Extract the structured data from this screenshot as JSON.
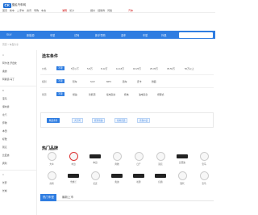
{
  "colors": {
    "brand_blue": "#2f7de1",
    "accent_red": "#cc0000"
  },
  "header": {
    "logo_mark": "CK",
    "logo_text": "惠民汽车网",
    "top_links": [
      "首页",
      "新车",
      "二手车",
      "资讯",
      "导购",
      "车友"
    ],
    "city_links": [
      "湖南",
      "长沙"
    ],
    "right_links": [
      "报价",
      "经销商",
      "问答"
    ],
    "brand_text": "汽车"
  },
  "nav": {
    "items": [
      "SUV",
      "新能源",
      "车型",
      "试驾",
      "新手导购",
      "选车",
      "车型",
      "外观",
      "文章"
    ],
    "search_placeholder": ""
  },
  "breadcrumb": "首页 > 车型大全",
  "sidebar": {
    "items": [
      "A",
      "阿尔法·罗密欧",
      "奥迪",
      "阿斯顿·马丁",
      "B",
      "宝马",
      "保时捷",
      "北汽",
      "奔驰",
      "本田",
      "标致",
      "别克",
      "比亚迪",
      "宾利",
      "C",
      "长安",
      "长城"
    ]
  },
  "filters": {
    "title": "选车条件",
    "rows": [
      {
        "label": "价格",
        "selected": "不限",
        "options": [
          "5万以下",
          "5-8万",
          "8-12万",
          "12-18万",
          "18-25万",
          "25-35万",
          "35-50万",
          "50万以上"
        ]
      },
      {
        "label": "级别",
        "selected": "不限",
        "options": [
          "轿车",
          "SUV",
          "MPV",
          "跑车",
          "皮卡",
          "微面"
        ]
      },
      {
        "label": "能源",
        "selected": "不限",
        "options": [
          "燃油",
          "新能源",
          "插电混动",
          "纯电",
          "油电混合",
          "增程式"
        ]
      }
    ],
    "tags": [
      "精选条件",
      "大空间",
      "经济省油",
      "家用首选",
      "高性价比"
    ]
  },
  "hot_brands": {
    "title": "热门品牌",
    "items": [
      {
        "name": "大众",
        "icon": "vw-logo-icon",
        "style": "circle"
      },
      {
        "name": "丰田",
        "icon": "toyota-logo-icon",
        "style": "red"
      },
      {
        "name": "本田",
        "icon": "honda-logo-icon",
        "style": "wide"
      },
      {
        "name": "奔驰",
        "icon": "benz-logo-icon",
        "style": "circle"
      },
      {
        "name": "日产",
        "icon": "nissan-logo-icon",
        "style": "circle"
      },
      {
        "name": "别克",
        "icon": "buick-logo-icon",
        "style": "circle"
      },
      {
        "name": "比亚迪",
        "icon": "byd-logo-icon",
        "style": "wide"
      },
      {
        "name": "宝马",
        "icon": "bmw-logo-icon",
        "style": "circle"
      },
      {
        "name": "吉利",
        "icon": "geely-logo-icon",
        "style": "circle"
      },
      {
        "name": "雪佛兰",
        "icon": "chevrolet-logo-icon",
        "style": "wide"
      },
      {
        "name": "长安",
        "icon": "changan-logo-icon",
        "style": "circle"
      },
      {
        "name": "奥迪",
        "icon": "audi-logo-icon",
        "style": "wide"
      },
      {
        "name": "哈弗",
        "icon": "haval-logo-icon",
        "style": "wide"
      },
      {
        "name": "红旗",
        "icon": "hongqi-logo-icon",
        "style": "wide"
      },
      {
        "name": "现代",
        "icon": "hyundai-logo-icon",
        "style": "circle"
      },
      {
        "name": "宝马",
        "icon": "bmw2-logo-icon",
        "style": "circle"
      }
    ]
  },
  "hot_models": {
    "tabs": [
      "热门车型",
      "最新上市"
    ]
  }
}
